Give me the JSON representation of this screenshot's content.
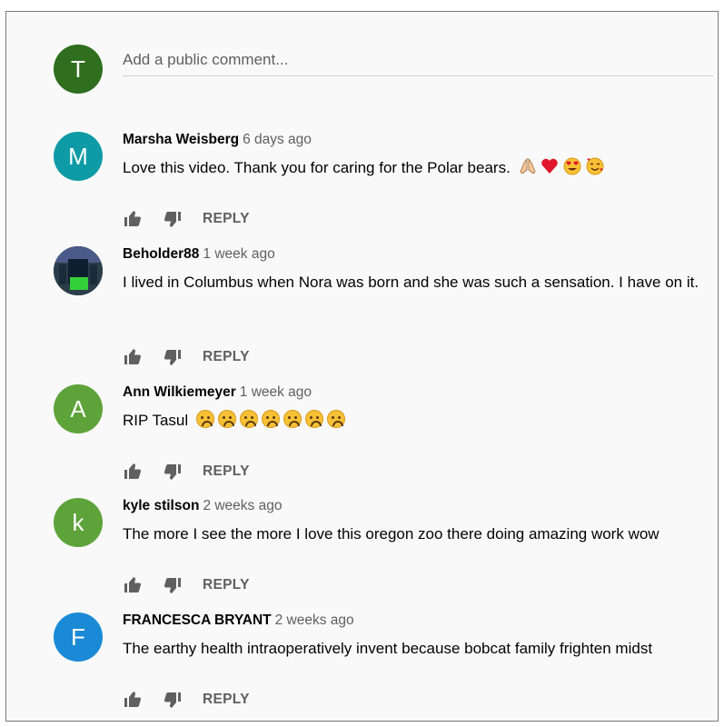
{
  "compose": {
    "avatar_letter": "T",
    "avatar_color": "#2e6e1e",
    "placeholder": "Add a public comment..."
  },
  "action_icons": [
    "thumb-up-icon",
    "thumb-down-icon"
  ],
  "comments": [
    {
      "author": "Marsha Weisberg",
      "time": "6 days ago",
      "avatar_letter": "M",
      "avatar_color": "#0f9ba6",
      "text": "Love this video. Thank you for caring for the Polar bears.",
      "emojis": [
        "folded-hands-emoji",
        "red-heart-emoji",
        "heart-eyes-emoji",
        "smiling-face-with-hearts-emoji"
      ],
      "reply": "REPLY"
    },
    {
      "author": "Beholder88",
      "time": "1 week ago",
      "avatar_letter": "",
      "avatar_color": "#2c3d4a",
      "text": "I lived in Columbus when Nora was born and she was such a sensation. I have on it.",
      "reply": "REPLY"
    },
    {
      "author": "Ann Wilkiemeyer",
      "time": "1 week ago",
      "avatar_letter": "A",
      "avatar_color": "#5ea33a",
      "text": "RIP Tasul",
      "emojis": [
        "sad-face-emoji",
        "sad-face-emoji",
        "sad-face-emoji",
        "sad-face-emoji",
        "sad-face-emoji",
        "sad-face-emoji",
        "sad-face-emoji"
      ],
      "reply": "REPLY"
    },
    {
      "author": "kyle stilson",
      "time": "2 weeks ago",
      "avatar_letter": "k",
      "avatar_color": "#5ea33a",
      "text": "The more I see the more I love this oregon zoo there doing amazing work wow",
      "reply": "REPLY"
    },
    {
      "author": "FRANCESCA BRYANT",
      "time": "2 weeks ago",
      "avatar_letter": "F",
      "avatar_color": "#1a8ad6",
      "text": "The earthy health intraoperatively invent because bobcat family frighten midst",
      "reply": "REPLY"
    }
  ]
}
